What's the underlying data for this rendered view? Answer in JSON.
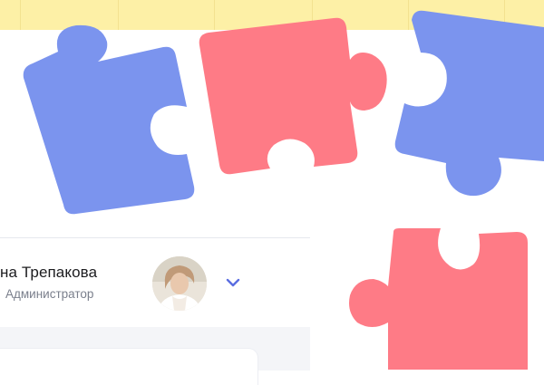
{
  "user": {
    "name": "на Трепакова",
    "role": "Администратор"
  },
  "icons": {
    "avatar": "avatar-photo",
    "dropdown": "chevron-down-icon",
    "puzzle": "puzzle-piece-icon"
  },
  "colors": {
    "band": "#fdf0a6",
    "puzzle_blue": "#7b94ee",
    "puzzle_red": "#fe7b86",
    "chevron": "#5b6ee1",
    "role_text": "#7a7f8c"
  }
}
